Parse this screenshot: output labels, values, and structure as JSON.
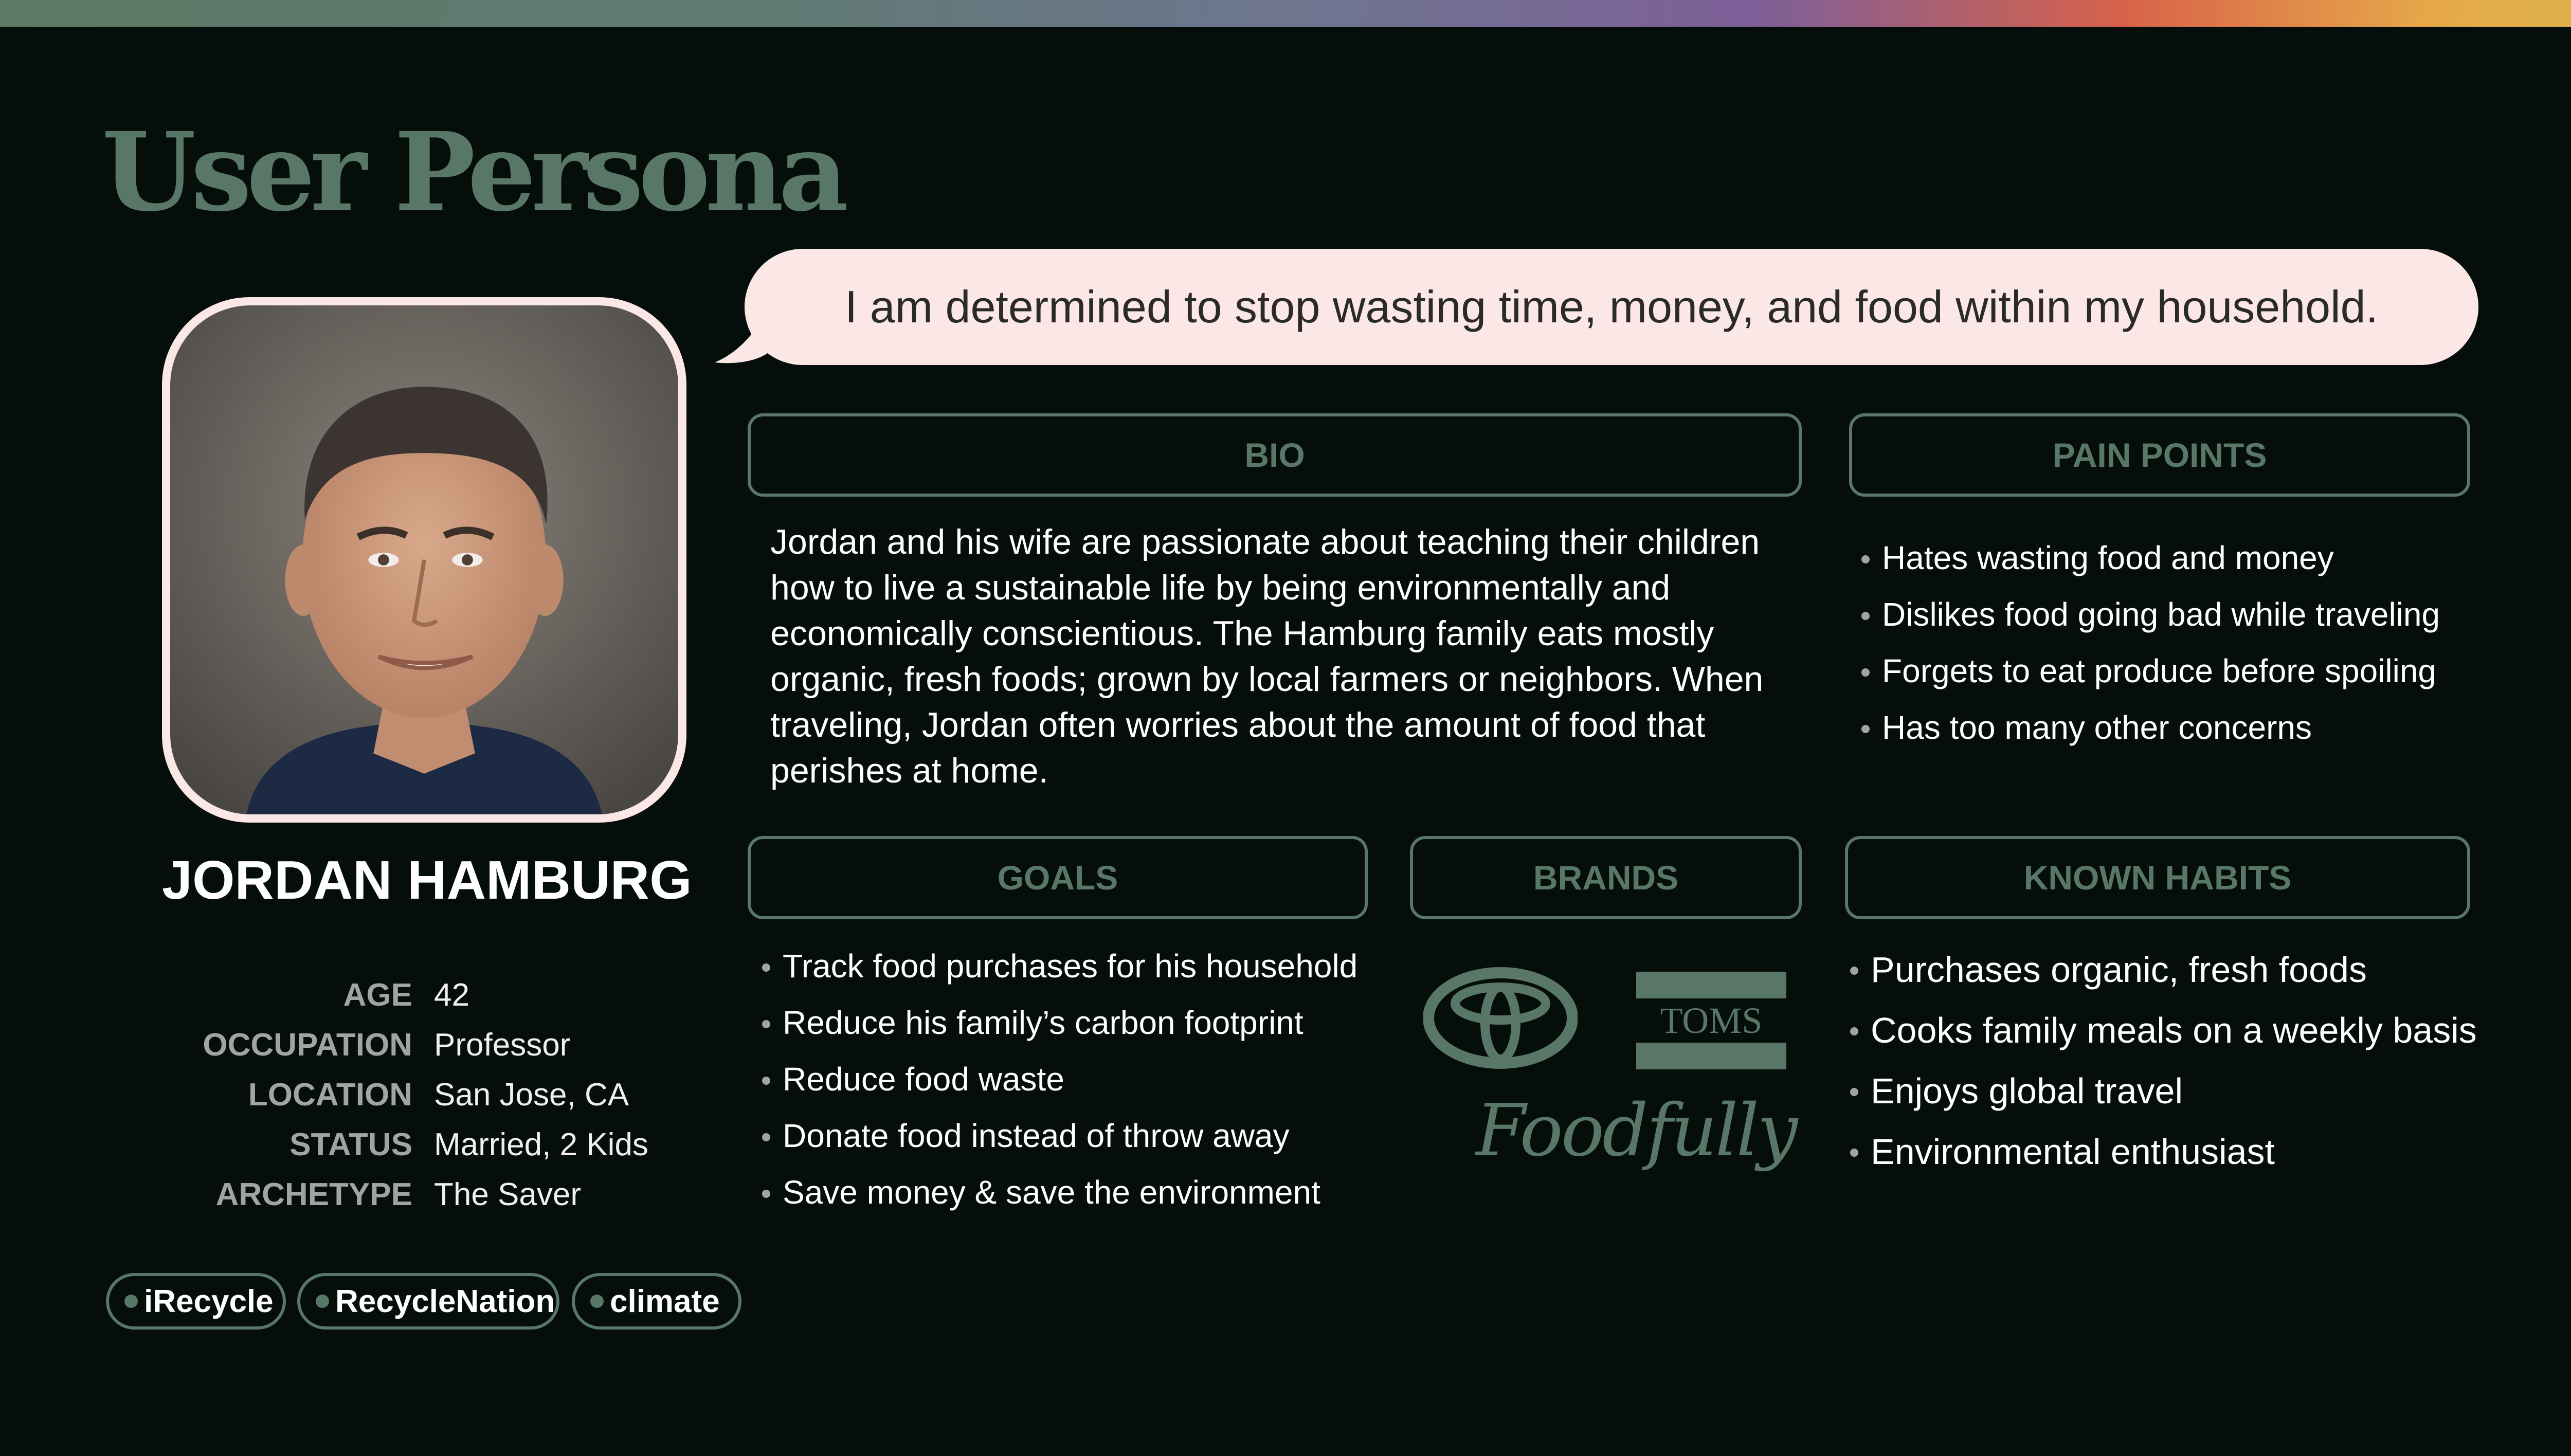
{
  "page": {
    "title": "User Persona",
    "quote": "I am determined to stop wasting time, money, and food within my household."
  },
  "persona": {
    "name": "JORDAN HAMBURG",
    "details": [
      {
        "label": "AGE",
        "value": "42"
      },
      {
        "label": "OCCUPATION",
        "value": "Professor"
      },
      {
        "label": "LOCATION",
        "value": "San Jose, CA"
      },
      {
        "label": "STATUS",
        "value": "Married, 2 Kids"
      },
      {
        "label": "ARCHETYPE",
        "value": "The Saver"
      }
    ],
    "tags": [
      "iRecycle",
      "RecycleNation",
      "climate"
    ]
  },
  "sections": {
    "bio": {
      "heading": "BIO",
      "lines": [
        "Jordan and his wife are passionate about teaching their children",
        "how to live a sustainable life by being environmentally and",
        "economically conscientious. The Hamburg family eats mostly",
        "organic, fresh foods; grown by local farmers or neighbors. When",
        "traveling, Jordan often worries about the amount of food that",
        "perishes at home."
      ]
    },
    "pain_points": {
      "heading": "PAIN POINTS",
      "items": [
        "Hates wasting food and money",
        "Dislikes food going bad while traveling",
        "Forgets to eat produce before spoiling",
        "Has too many other concerns"
      ]
    },
    "goals": {
      "heading": "GOALS",
      "items": [
        "Track food purchases for his household",
        "Reduce his family’s carbon footprint",
        "Reduce food waste",
        "Donate food instead of throw away",
        "Save money & save the environment"
      ]
    },
    "brands": {
      "heading": "BRANDS",
      "logos": [
        {
          "icon": "toyota-logo-icon"
        },
        {
          "icon": "toms-logo-icon",
          "text": "TOMS"
        },
        {
          "icon": "foodfully-logo-icon",
          "text": "Foodfully"
        }
      ]
    },
    "known_habits": {
      "heading": "KNOWN HABITS",
      "items": [
        "Purchases organic, fresh foods",
        "Cooks family meals on a weekly basis",
        "Enjoys global travel",
        "Environmental enthusiast"
      ]
    }
  },
  "colors": {
    "background": "#060e0b",
    "accent_green": "#587766",
    "bubble_pink": "#fbe8e6",
    "label_gray": "#9fa5a2"
  }
}
